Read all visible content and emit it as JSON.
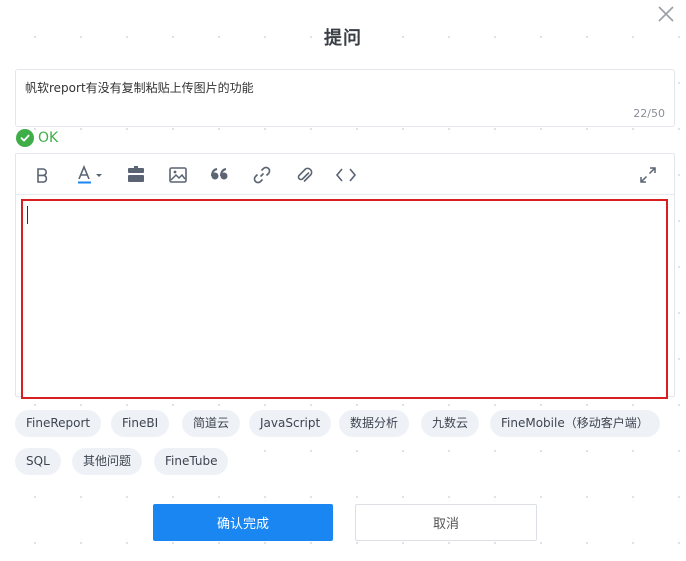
{
  "dialog": {
    "title": "提问",
    "close_icon": "close-icon"
  },
  "question": {
    "value": "帆软report有没有复制粘贴上传图片的功能",
    "counter": "22/50"
  },
  "validation": {
    "status": "OK",
    "color": "#3fae49",
    "icon": "check-circle-icon"
  },
  "editor": {
    "toolbar": [
      {
        "name": "bold-icon"
      },
      {
        "name": "font-color-icon"
      },
      {
        "name": "divider-icon"
      },
      {
        "name": "image-icon"
      },
      {
        "name": "quote-icon"
      },
      {
        "name": "link-icon"
      },
      {
        "name": "attachment-icon"
      },
      {
        "name": "code-icon"
      },
      {
        "name": "fullscreen-icon"
      }
    ],
    "content": "",
    "highlight_color": "#d81e1e"
  },
  "tags": [
    "FineReport",
    "FineBI",
    "简道云",
    "JavaScript",
    "数据分析",
    "九数云",
    "FineMobile（移动客户端）",
    "SQL",
    "其他问题",
    "FineTube"
  ],
  "actions": {
    "confirm_label": "确认完成",
    "cancel_label": "取消",
    "primary_color": "#1a86f2"
  }
}
